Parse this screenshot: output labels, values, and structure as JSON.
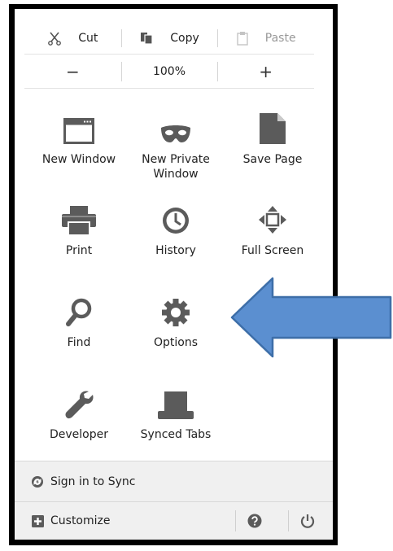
{
  "edit": {
    "cut_label": "Cut",
    "copy_label": "Copy",
    "paste_label": "Paste"
  },
  "zoom": {
    "minus_label": "−",
    "level": "100%",
    "plus_label": "+"
  },
  "tiles": [
    {
      "label": "New Window",
      "icon": "window-icon"
    },
    {
      "label": "New Private Window",
      "icon": "mask-icon"
    },
    {
      "label": "Save Page",
      "icon": "page-icon"
    },
    {
      "label": "Print",
      "icon": "printer-icon"
    },
    {
      "label": "History",
      "icon": "clock-icon"
    },
    {
      "label": "Full Screen",
      "icon": "fullscreen-icon"
    },
    {
      "label": "Find",
      "icon": "magnifier-icon"
    },
    {
      "label": "Options",
      "icon": "gear-icon"
    },
    {
      "label": "Developer",
      "icon": "wrench-icon"
    },
    {
      "label": "Synced Tabs",
      "icon": "synced-tabs-icon"
    }
  ],
  "sync": {
    "label": "Sign in to Sync"
  },
  "footer": {
    "customize_label": "Customize"
  },
  "colors": {
    "icon_gray": "#5b5b5b",
    "arrow_fill": "#5b8fd0",
    "arrow_stroke": "#3d6ea8",
    "footer_bg": "#f0f0f0"
  }
}
